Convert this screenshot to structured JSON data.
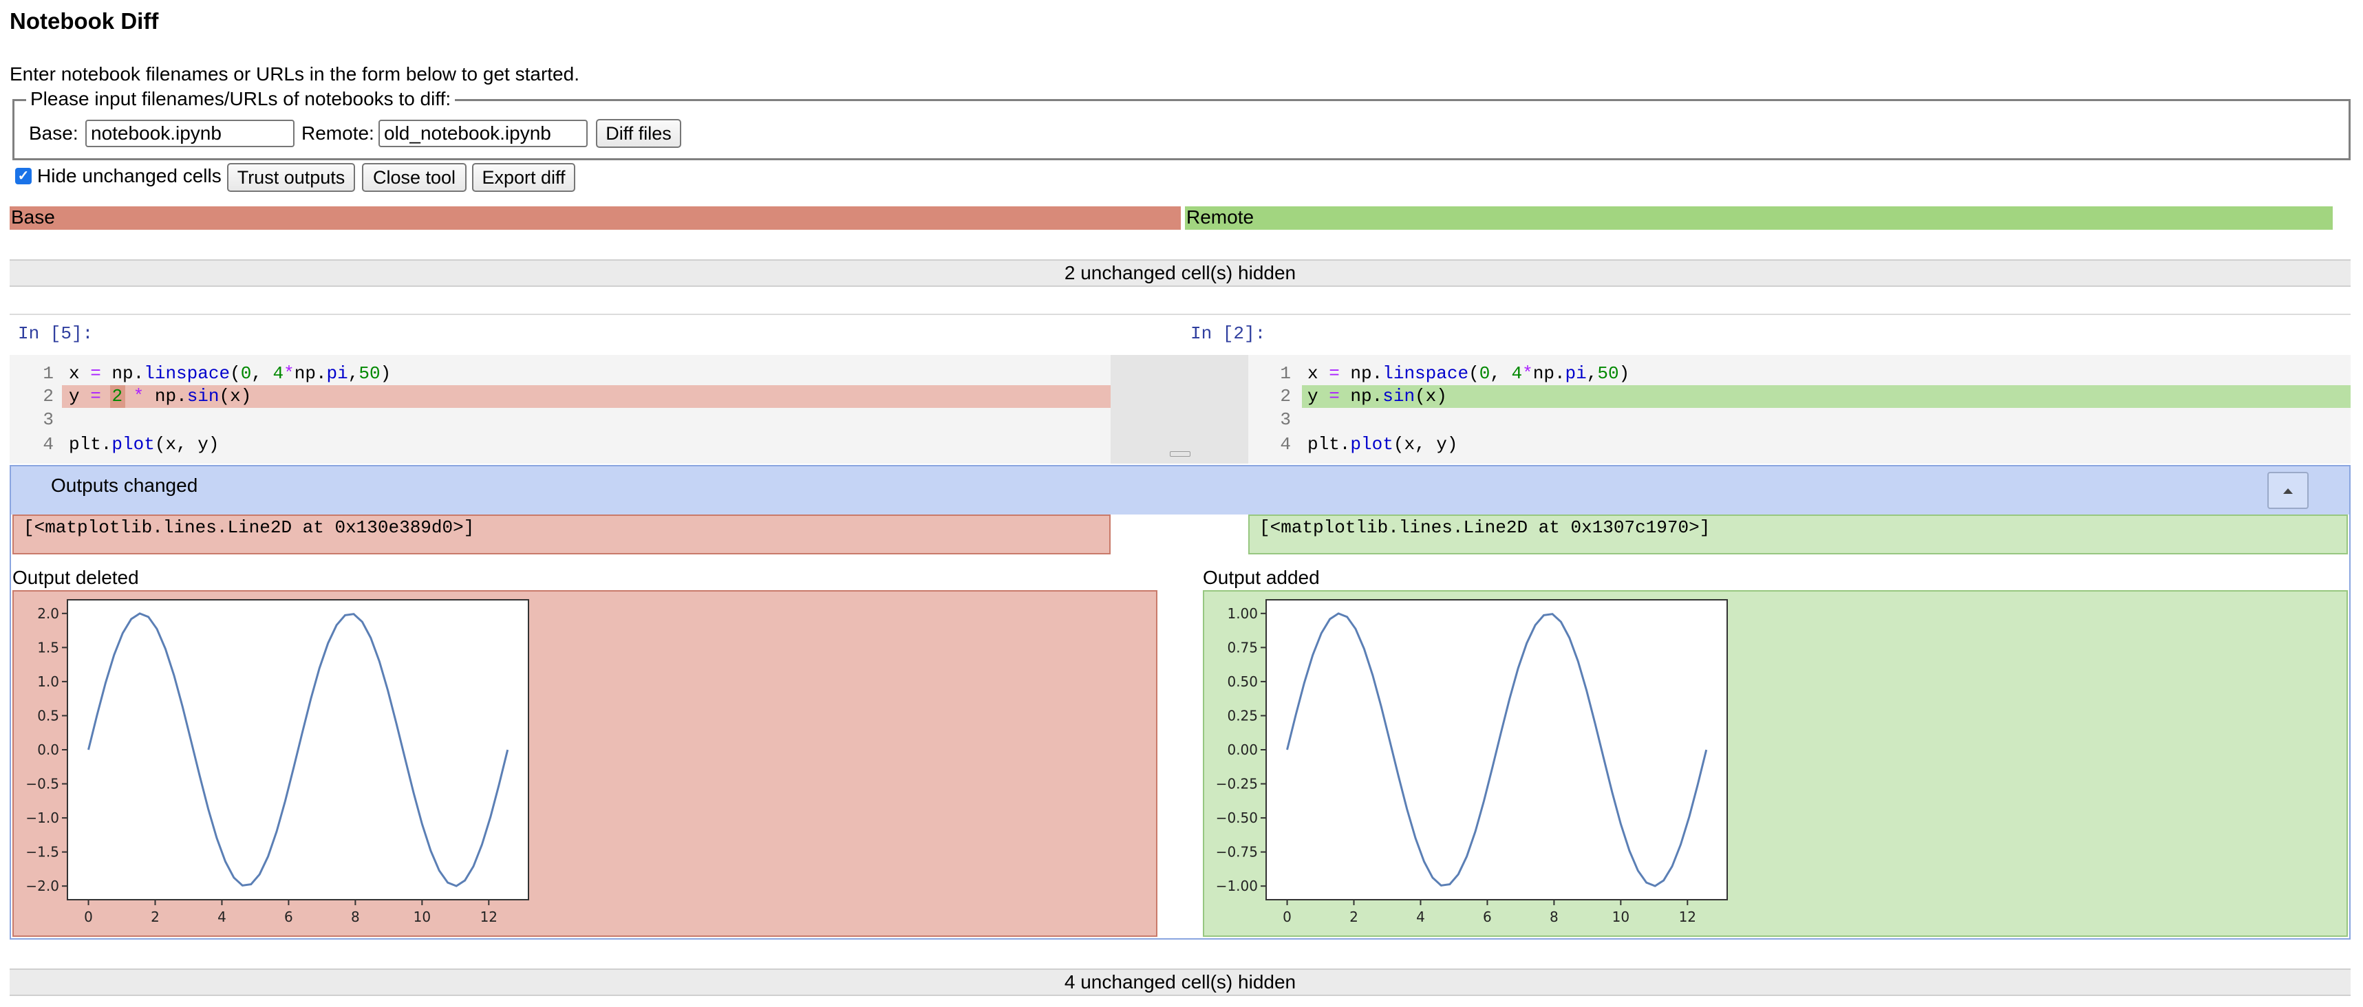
{
  "title": "Notebook Diff",
  "intro": "Enter notebook filenames or URLs in the form below to get started.",
  "form": {
    "legend": "Please input filenames/URLs of notebooks to diff:",
    "base_label": "Base:",
    "base_value": "notebook.ipynb",
    "remote_label": "Remote:",
    "remote_value": "old_notebook.ipynb",
    "diff_button": "Diff files"
  },
  "toolbar": {
    "hide_unchanged_label": "Hide unchanged cells",
    "hide_unchanged_checked": true,
    "trust_outputs": "Trust outputs",
    "close_tool": "Close tool",
    "export_diff": "Export diff"
  },
  "headers": {
    "base": "Base",
    "remote": "Remote"
  },
  "colors": {
    "base_header": "#d88a79",
    "remote_header": "#a2d580",
    "deleted_bg": "#ebbdb4",
    "added_bg": "#cfe9c1",
    "outputs_bar": "#c5d4f5"
  },
  "hidden_top": "2 unchanged cell(s) hidden",
  "hidden_bottom": "4 unchanged cell(s) hidden",
  "cell": {
    "base_prompt": "In [5]:",
    "remote_prompt": "In [2]:",
    "line_numbers": [
      "1",
      "2",
      "3",
      "4"
    ],
    "base_line1": {
      "a": "x ",
      "b": "=",
      "c": " np.",
      "d": "linspace",
      "e": "(",
      "f": "0",
      "g": ", ",
      "h": "4",
      "i": "*",
      "j": "np.",
      "k": "pi",
      "l": ",",
      "m": "50",
      "n": ")"
    },
    "base_line2": {
      "a": "y ",
      "b": "=",
      "c": " ",
      "d": "2",
      "e": " ",
      "f": "*",
      "g": " np.",
      "h": "sin",
      "i": "(x)"
    },
    "base_line4": {
      "a": "plt.",
      "b": "plot",
      "c": "(x, y)"
    },
    "remote_line2": {
      "a": "y ",
      "b": "=",
      "c": " np.",
      "d": "sin",
      "e": "(x)"
    }
  },
  "outputs": {
    "bar_label": "Outputs changed",
    "collapse_icon": "caret-up-icon",
    "base_text": "[<matplotlib.lines.Line2D at 0x130e389d0>]",
    "remote_text": "[<matplotlib.lines.Line2D at 0x1307c1970>]",
    "deleted_label": "Output deleted",
    "added_label": "Output added"
  },
  "chart_data": [
    {
      "type": "line",
      "title": "",
      "xlabel": "",
      "ylabel": "",
      "xlim": [
        -0.63,
        13.19
      ],
      "ylim": [
        -2.2,
        2.2
      ],
      "x_ticks": [
        "0",
        "2",
        "4",
        "6",
        "8",
        "10",
        "12"
      ],
      "y_ticks": [
        "2.0",
        "1.5",
        "1.0",
        "0.5",
        "0.0",
        "−0.5",
        "−1.0",
        "−1.5",
        "−2.0"
      ],
      "series": [
        {
          "x_start": 0,
          "x_end": 12.566,
          "n_points": 50,
          "amplitude": 2,
          "function": "sin",
          "color": "#5b7fb5"
        }
      ]
    },
    {
      "type": "line",
      "title": "",
      "xlabel": "",
      "ylabel": "",
      "xlim": [
        -0.63,
        13.19
      ],
      "ylim": [
        -1.1,
        1.1
      ],
      "x_ticks": [
        "0",
        "2",
        "4",
        "6",
        "8",
        "10",
        "12"
      ],
      "y_ticks": [
        "1.00",
        "0.75",
        "0.50",
        "0.25",
        "0.00",
        "−0.25",
        "−0.50",
        "−0.75",
        "−1.00"
      ],
      "series": [
        {
          "x_start": 0,
          "x_end": 12.566,
          "n_points": 50,
          "amplitude": 1,
          "function": "sin",
          "color": "#5b7fb5"
        }
      ]
    }
  ]
}
